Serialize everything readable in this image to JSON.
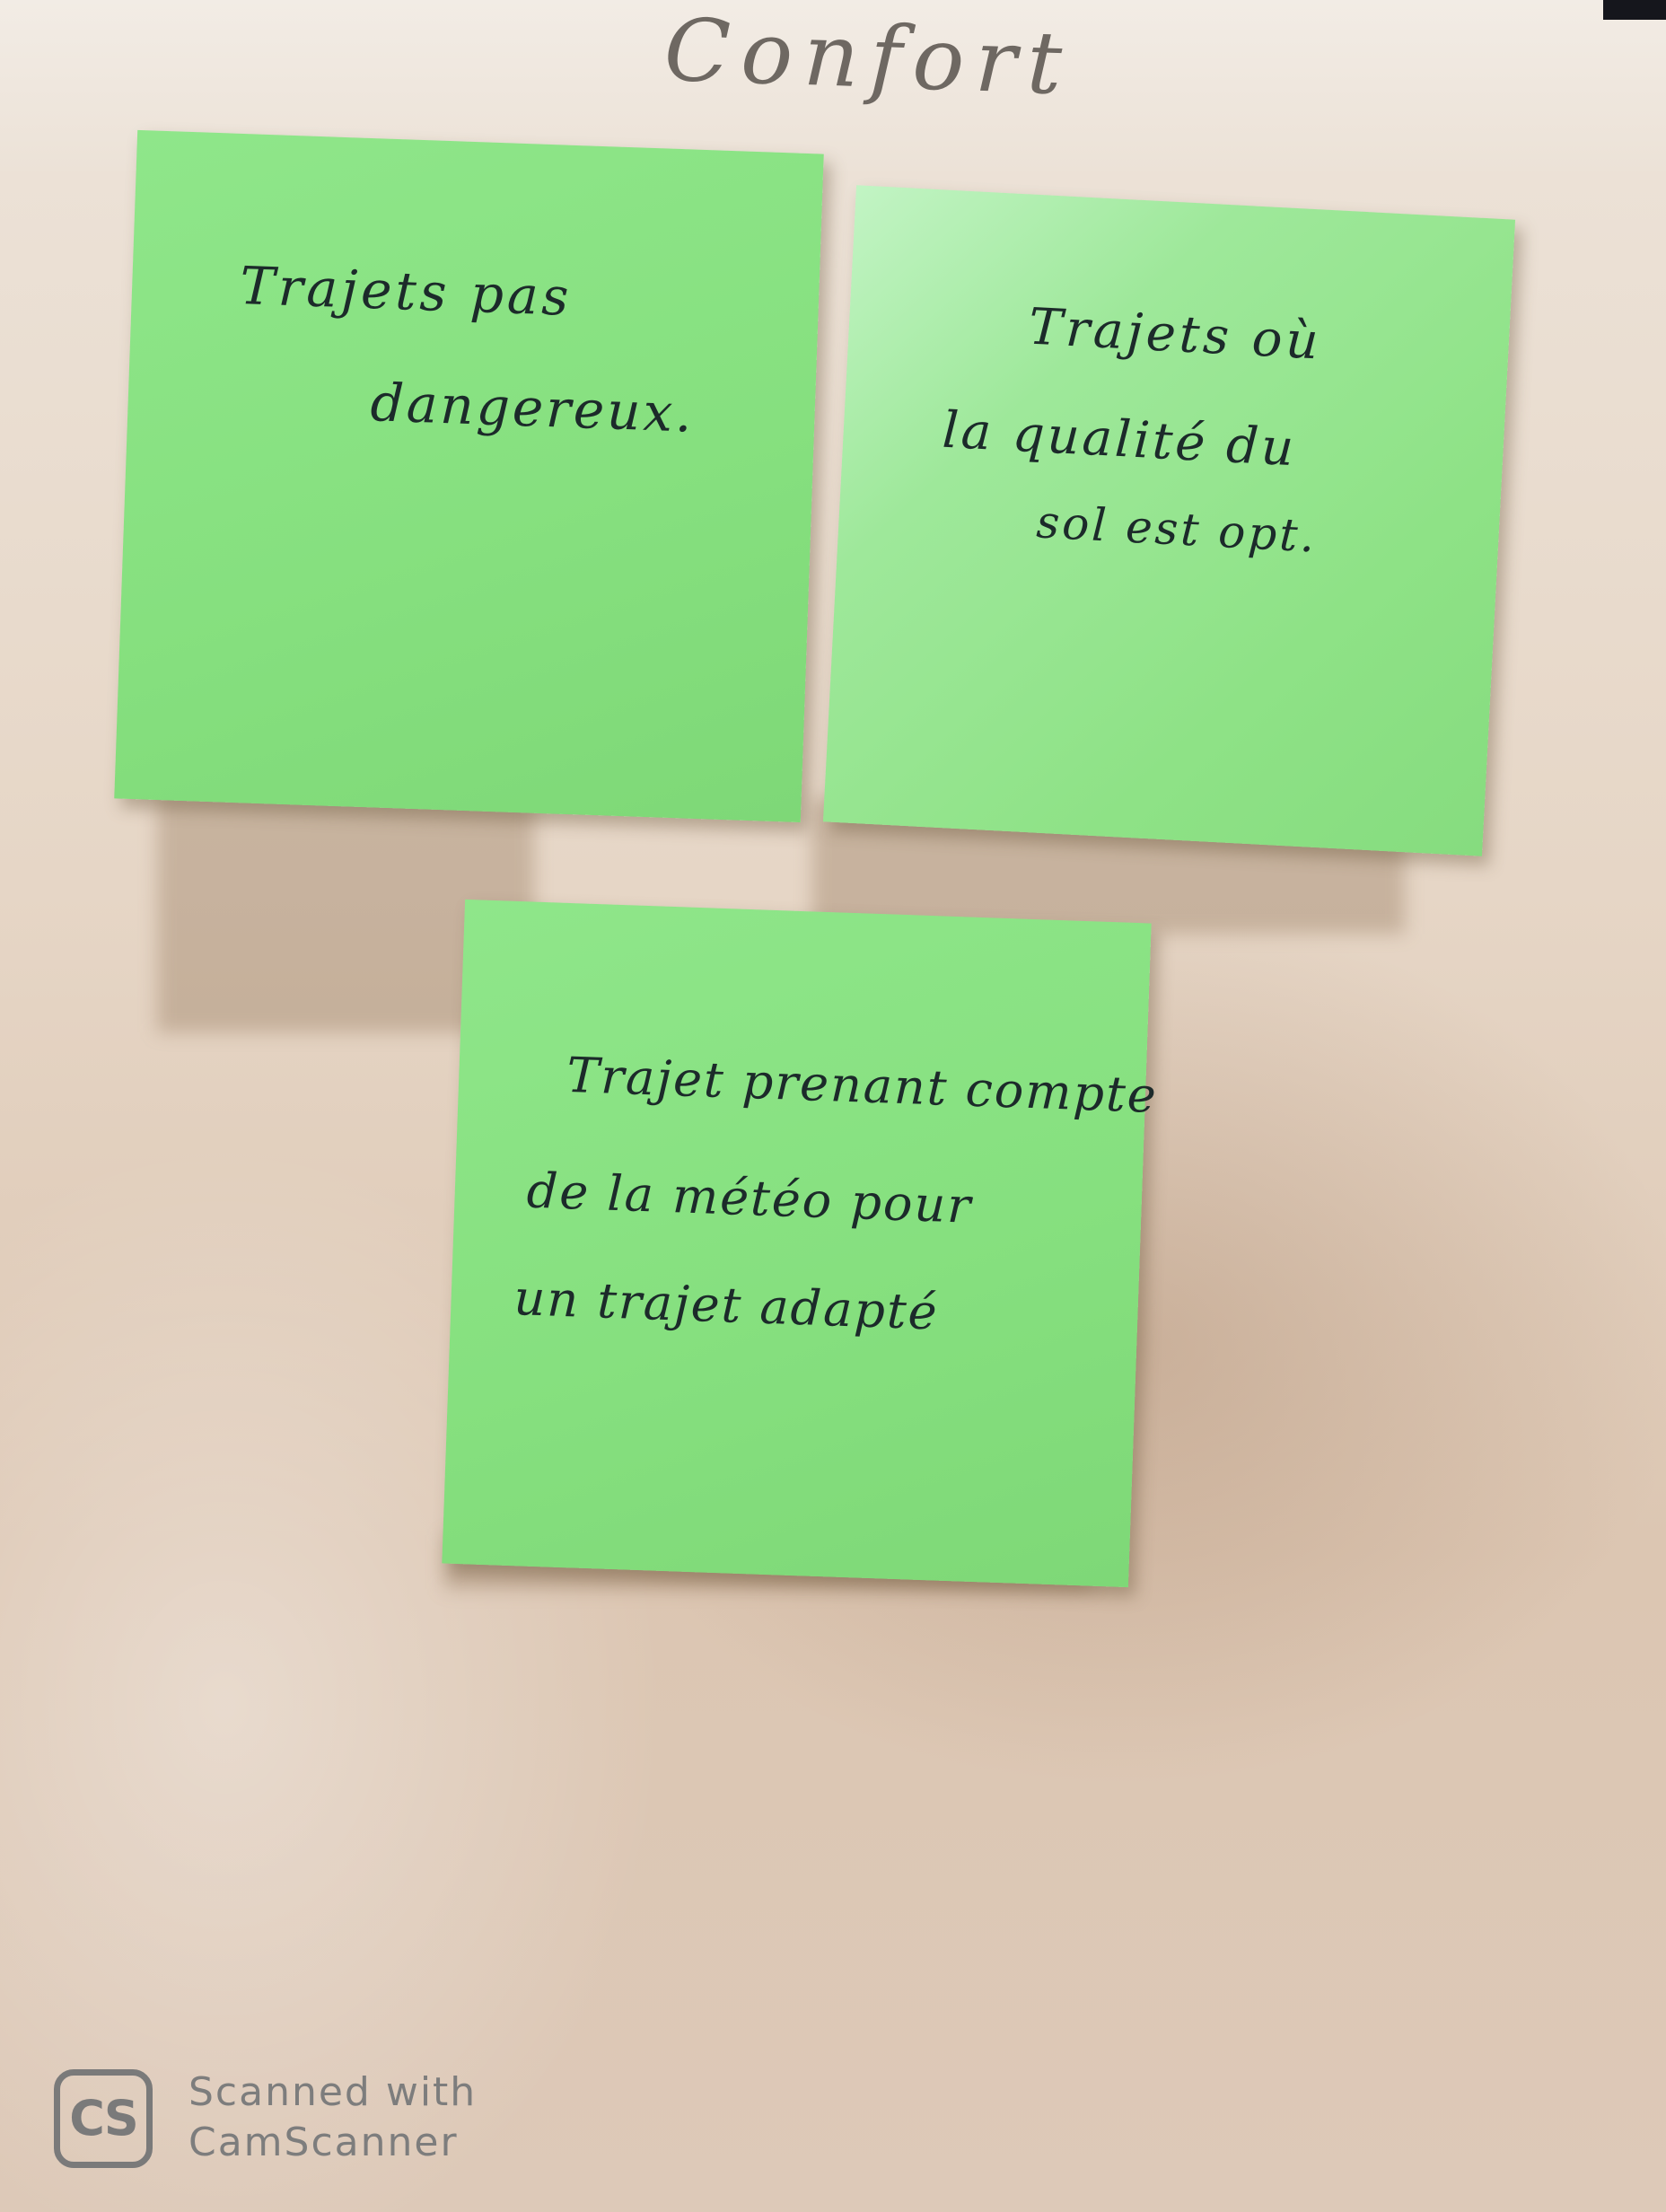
{
  "heading": "Confort",
  "notes": [
    {
      "lines": [
        "Trajets pas",
        "dangereux."
      ]
    },
    {
      "lines": [
        "Trajets où",
        "la qualité du",
        "sol est opt."
      ]
    },
    {
      "lines": [
        "Trajet prenant compte",
        "de la météo pour",
        "un trajet adapté"
      ]
    }
  ],
  "watermark": {
    "logo": "CS",
    "line1": "Scanned with",
    "line2": "CamScanner"
  },
  "colors": {
    "note_green": "#8ee286",
    "paper": "#e6d6c6",
    "ink": "#1c2a2a"
  }
}
